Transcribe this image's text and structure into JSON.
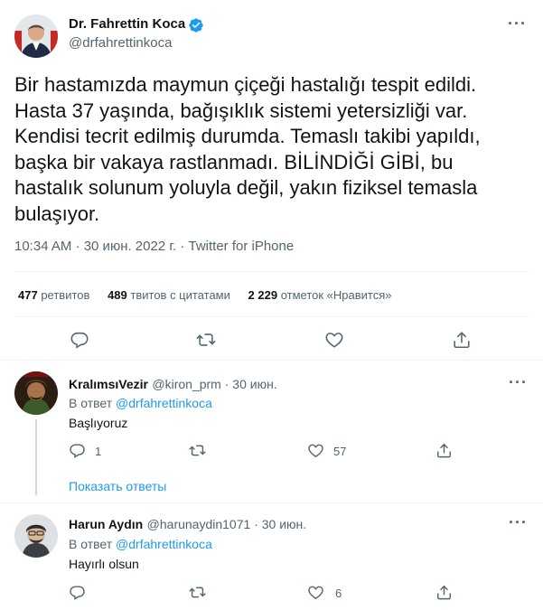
{
  "tweet": {
    "author_name": "Dr. Fahrettin Koca",
    "author_handle": "@drfahrettinkoca",
    "lines": [
      "Bir hastamızda maymun çiçeği hastalığı tespit edildi.",
      "Hasta 37 yaşında, bağışıklık sistemi yetersizliği var.",
      "Kendisi tecrit edilmiş durumda. Temaslı takibi yapıldı,",
      "başka bir vakaya rastlanmadı. BİLİNDİĞİ GİBİ, bu",
      "hastalık solunum yoluyla değil, yakın fiziksel temasla",
      "bulaşıyor."
    ],
    "meta": "10:34 AM · 30 июн. 2022 г. · Twitter for iPhone",
    "stats": {
      "retweets_count": "477",
      "retweets_label": "ретвитов",
      "quotes_count": "489",
      "quotes_label": "твитов с цитатами",
      "likes_count": "2 229",
      "likes_label": "отметок «Нравится»"
    }
  },
  "replies": [
    {
      "name": "KralımsıVezir",
      "handle_time": "@kiron_prm · 30 июн.",
      "reply_to_prefix": "В ответ ",
      "reply_to_handle": "@drfahrettinkoca",
      "text": "Başlıyoruz",
      "reply_count": "1",
      "like_count": "57",
      "show_replies": "Показать ответы"
    },
    {
      "name": "Harun Aydın",
      "handle_time": "@harunaydin1071 · 30 июн.",
      "reply_to_prefix": "В ответ ",
      "reply_to_handle": "@drfahrettinkoca",
      "text": "Hayırlı olsun",
      "like_count": "6"
    }
  ],
  "icons": {
    "verified_badge": "verified-badge-icon",
    "more": "more-icon",
    "reply": "reply-icon",
    "retweet": "retweet-icon",
    "like": "like-icon",
    "share": "share-icon"
  },
  "colors": {
    "accent": "#1d9bf0",
    "text": "#0f1419",
    "secondary": "#536471",
    "divider": "#eff3f4"
  }
}
